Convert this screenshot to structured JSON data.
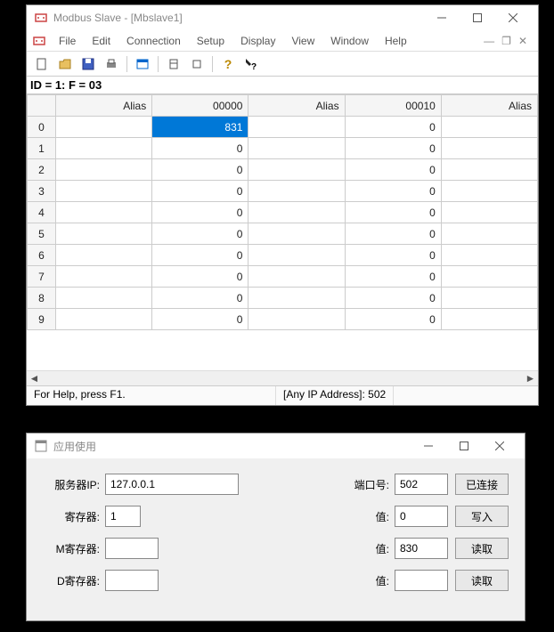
{
  "win1": {
    "title": "Modbus Slave - [Mbslave1]",
    "menu": [
      "File",
      "Edit",
      "Connection",
      "Setup",
      "Display",
      "View",
      "Window",
      "Help"
    ],
    "status_line": "ID = 1: F = 03",
    "columns": [
      "Alias",
      "00000",
      "Alias",
      "00010",
      "Alias"
    ],
    "rows": [
      {
        "idx": "0",
        "c0": "",
        "c1": "831",
        "c2": "",
        "c3": "0",
        "c4": ""
      },
      {
        "idx": "1",
        "c0": "",
        "c1": "0",
        "c2": "",
        "c3": "0",
        "c4": ""
      },
      {
        "idx": "2",
        "c0": "",
        "c1": "0",
        "c2": "",
        "c3": "0",
        "c4": ""
      },
      {
        "idx": "3",
        "c0": "",
        "c1": "0",
        "c2": "",
        "c3": "0",
        "c4": ""
      },
      {
        "idx": "4",
        "c0": "",
        "c1": "0",
        "c2": "",
        "c3": "0",
        "c4": ""
      },
      {
        "idx": "5",
        "c0": "",
        "c1": "0",
        "c2": "",
        "c3": "0",
        "c4": ""
      },
      {
        "idx": "6",
        "c0": "",
        "c1": "0",
        "c2": "",
        "c3": "0",
        "c4": ""
      },
      {
        "idx": "7",
        "c0": "",
        "c1": "0",
        "c2": "",
        "c3": "0",
        "c4": ""
      },
      {
        "idx": "8",
        "c0": "",
        "c1": "0",
        "c2": "",
        "c3": "0",
        "c4": ""
      },
      {
        "idx": "9",
        "c0": "",
        "c1": "0",
        "c2": "",
        "c3": "0",
        "c4": ""
      }
    ],
    "statusbar": {
      "help": "For Help, press F1.",
      "conn": "[Any IP Address]: 502"
    }
  },
  "win2": {
    "title": "应用使用",
    "labels": {
      "server_ip": "服务器IP:",
      "port": "端口号:",
      "register": "寄存器:",
      "value": "值:",
      "m_register": "M寄存器:",
      "d_register": "D寄存器:"
    },
    "values": {
      "server_ip": "127.0.0.1",
      "port": "502",
      "register": "1",
      "value1": "0",
      "m_register": "",
      "value2": "830",
      "d_register": "",
      "value3": ""
    },
    "buttons": {
      "connected": "已连接",
      "write": "写入",
      "read1": "读取",
      "read2": "读取"
    }
  }
}
